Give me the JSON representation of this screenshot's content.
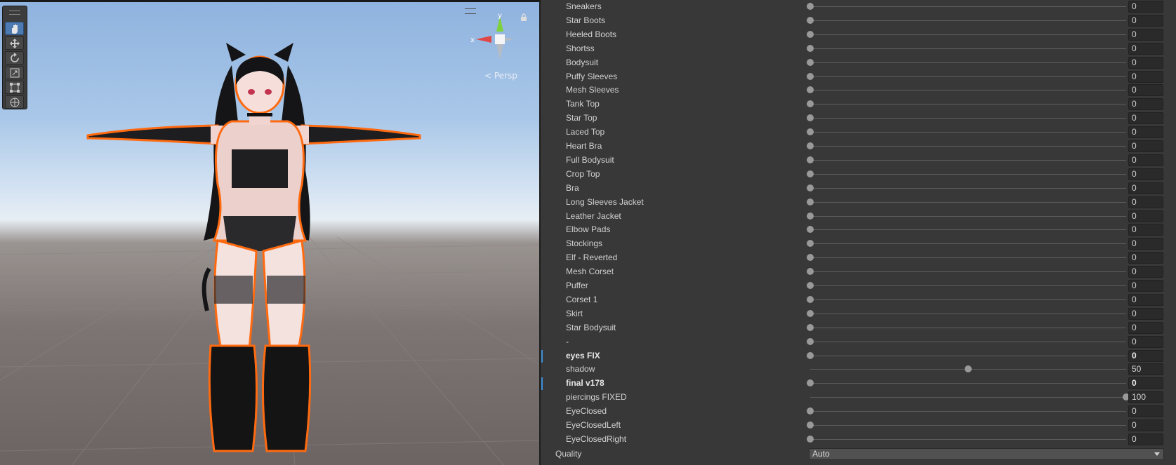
{
  "scene": {
    "persp_label": "< Persp",
    "gizmo": {
      "x_label": "x",
      "y_label": "y"
    },
    "tools": [
      {
        "name": "hand-tool",
        "active": true
      },
      {
        "name": "move-tool",
        "active": false
      },
      {
        "name": "rotate-tool",
        "active": false
      },
      {
        "name": "scale-tool",
        "active": false
      },
      {
        "name": "rect-tool",
        "active": false
      },
      {
        "name": "transform-tool",
        "active": false
      }
    ]
  },
  "inspector": {
    "blendshapes": [
      {
        "label": "Sneakers",
        "value": "0",
        "level": 0
      },
      {
        "label": "Star Boots",
        "value": "0",
        "level": 0
      },
      {
        "label": "Heeled Boots",
        "value": "0",
        "level": 0
      },
      {
        "label": "Shortss",
        "value": "0",
        "level": 0
      },
      {
        "label": "Bodysuit",
        "value": "0",
        "level": 0
      },
      {
        "label": "Puffy Sleeves",
        "value": "0",
        "level": 0
      },
      {
        "label": "Mesh Sleeves",
        "value": "0",
        "level": 0
      },
      {
        "label": "Tank Top",
        "value": "0",
        "level": 0
      },
      {
        "label": "Star Top",
        "value": "0",
        "level": 0
      },
      {
        "label": "Laced Top",
        "value": "0",
        "level": 0
      },
      {
        "label": "Heart Bra",
        "value": "0",
        "level": 0
      },
      {
        "label": "Full Bodysuit",
        "value": "0",
        "level": 0
      },
      {
        "label": "Crop Top",
        "value": "0",
        "level": 0
      },
      {
        "label": "Bra",
        "value": "0",
        "level": 0
      },
      {
        "label": "Long Sleeves Jacket",
        "value": "0",
        "level": 0
      },
      {
        "label": "Leather Jacket",
        "value": "0",
        "level": 0
      },
      {
        "label": "Elbow Pads",
        "value": "0",
        "level": 0
      },
      {
        "label": "Stockings",
        "value": "0",
        "level": 0
      },
      {
        "label": "Elf - Reverted",
        "value": "0",
        "level": 0
      },
      {
        "label": "Mesh Corset",
        "value": "0",
        "level": 0
      },
      {
        "label": "Puffer",
        "value": "0",
        "level": 0
      },
      {
        "label": "Corset 1",
        "value": "0",
        "level": 0
      },
      {
        "label": "Skirt",
        "value": "0",
        "level": 0
      },
      {
        "label": "Star Bodysuit",
        "value": "0",
        "level": 0
      },
      {
        "label": "-",
        "value": "0",
        "level": 0
      },
      {
        "label": "eyes FIX",
        "value": "0",
        "level": 0,
        "bold": true
      },
      {
        "label": "shadow",
        "value": "50",
        "level": 0.5
      },
      {
        "label": "final v178",
        "value": "0",
        "level": 0,
        "bold": true
      },
      {
        "label": "piercings FIXED",
        "value": "100",
        "level": 1
      },
      {
        "label": "EyeClosed",
        "value": "0",
        "level": 0
      },
      {
        "label": "EyeClosedLeft",
        "value": "0",
        "level": 0
      },
      {
        "label": "EyeClosedRight",
        "value": "0",
        "level": 0
      }
    ],
    "quality": {
      "label": "Quality",
      "value": "Auto"
    }
  },
  "colors": {
    "highlight_outline": "#ff6a10",
    "modified_marker": "#3d8fd6",
    "active_tool": "#4d7ab0"
  }
}
